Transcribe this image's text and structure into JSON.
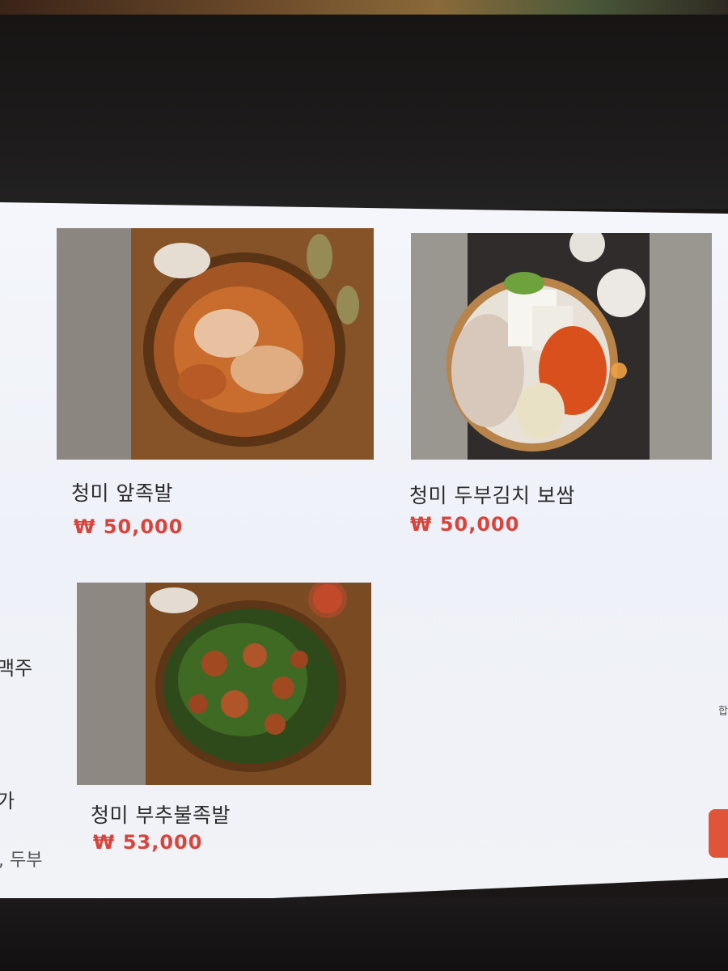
{
  "menu": {
    "items": [
      {
        "name": "청미 앞족발",
        "price": "₩ 50,000",
        "image": "braised-pork-trotters-photo"
      },
      {
        "name": "청미 두부김치 보쌈",
        "price": "₩ 50,000",
        "image": "bossam-tofu-kimchi-photo"
      },
      {
        "name": "청미 부추불족발",
        "price": "₩ 53,000",
        "image": "spicy-trotters-chives-photo"
      }
    ]
  },
  "sidebar": {
    "fragments": [
      "맥주",
      "가",
      ", 두부"
    ]
  },
  "right_edge": {
    "fragment": "합"
  },
  "colors": {
    "price": "#d9443c",
    "screen_bg": "#f2f4f8",
    "accent_button": "#e0553a"
  }
}
